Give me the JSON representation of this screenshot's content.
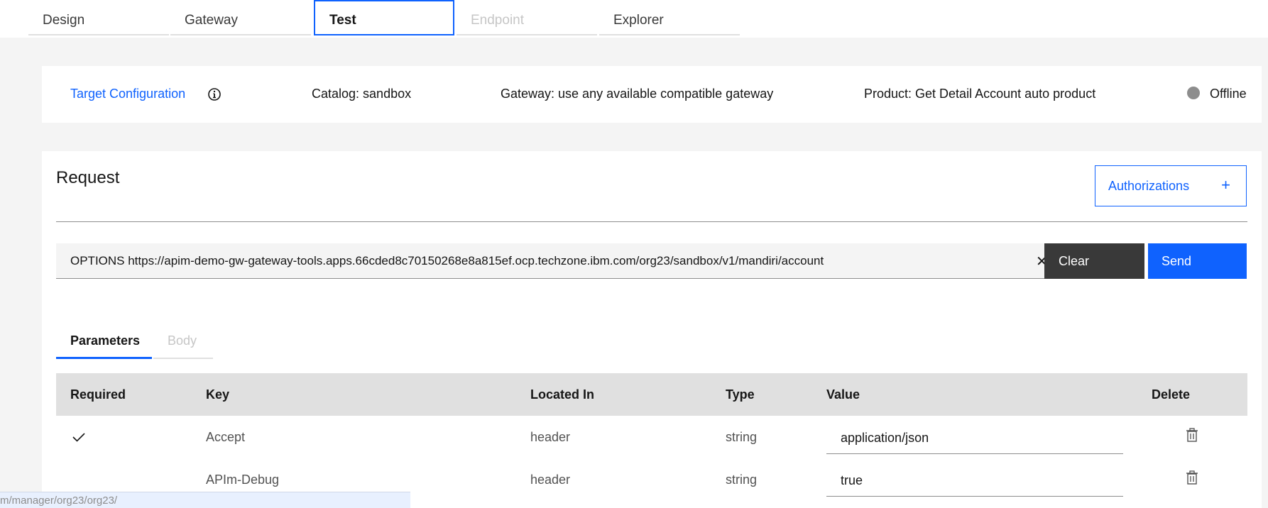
{
  "tabs": [
    {
      "label": "Design",
      "state": "normal"
    },
    {
      "label": "Gateway",
      "state": "normal"
    },
    {
      "label": "Test",
      "state": "active"
    },
    {
      "label": "Endpoint",
      "state": "disabled"
    },
    {
      "label": "Explorer",
      "state": "normal"
    }
  ],
  "target": {
    "link_label": "Target Configuration",
    "info_icon": "info-icon",
    "catalog": "Catalog: sandbox",
    "gateway": "Gateway: use any available compatible gateway",
    "product": "Product: Get Detail Account auto product",
    "status": "Offline",
    "status_color": "#8d8d8d"
  },
  "request": {
    "title": "Request",
    "authorizations_label": "Authorizations",
    "authorizations_icon": "+",
    "url_value": "OPTIONS https://apim-demo-gw-gateway-tools.apps.66cded8c70150268e8a815ef.ocp.techzone.ibm.com/org23/sandbox/v1/mandiri/account",
    "clear_x": "✕",
    "clear_label": "Clear",
    "send_label": "Send"
  },
  "param_tabs": {
    "parameters": "Parameters",
    "body": "Body"
  },
  "table": {
    "headers": {
      "required": "Required",
      "key": "Key",
      "located_in": "Located In",
      "type": "Type",
      "value": "Value",
      "delete": "Delete"
    },
    "rows": [
      {
        "required": true,
        "key": "Accept",
        "located_in": "header",
        "type": "string",
        "value": "application/json"
      },
      {
        "required": false,
        "key": "APIm-Debug",
        "located_in": "header",
        "type": "string",
        "value": "true"
      }
    ]
  },
  "status_bar": {
    "url": "m/manager/org23/org23/"
  },
  "colors": {
    "accent": "#0f62fe",
    "dark_button": "#393939"
  }
}
